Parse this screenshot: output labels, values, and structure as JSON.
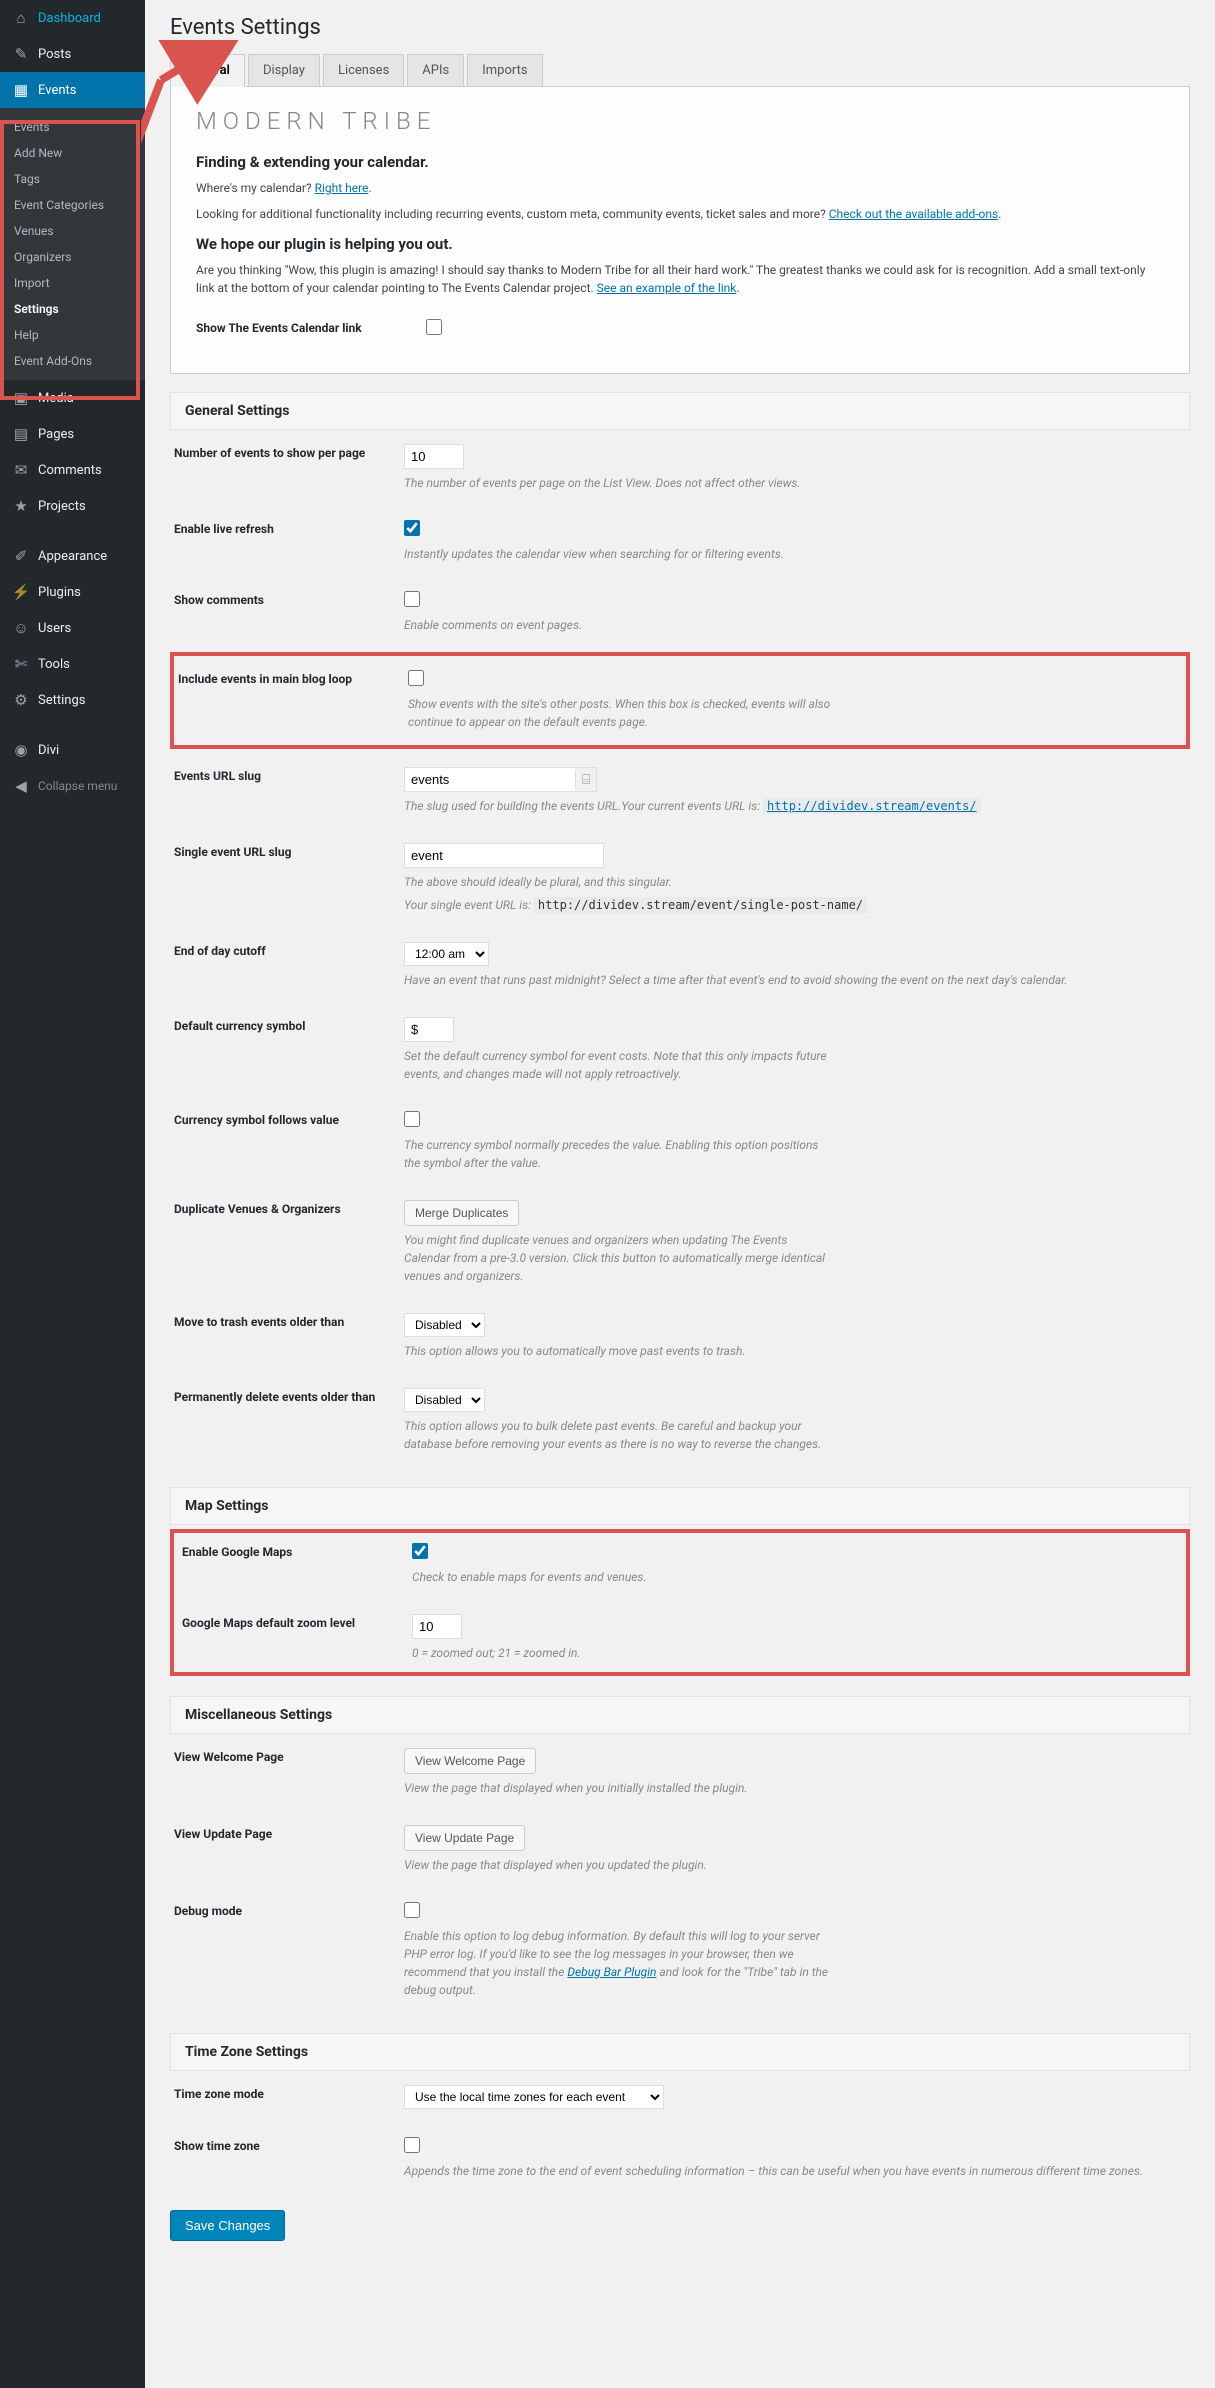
{
  "sidebar": {
    "dashboard": "Dashboard",
    "posts": "Posts",
    "events": "Events",
    "events_sub": [
      "Events",
      "Add New",
      "Tags",
      "Event Categories",
      "Venues",
      "Organizers",
      "Import",
      "Settings",
      "Help",
      "Event Add-Ons"
    ],
    "events_sub_selected_index": 7,
    "media": "Media",
    "pages": "Pages",
    "comments": "Comments",
    "projects": "Projects",
    "appearance": "Appearance",
    "plugins": "Plugins",
    "users": "Users",
    "tools": "Tools",
    "settings": "Settings",
    "divi": "Divi",
    "collapse": "Collapse menu"
  },
  "page_title": "Events Settings",
  "tabs": [
    "General",
    "Display",
    "Licenses",
    "APIs",
    "Imports"
  ],
  "intro": {
    "brand": "MODERN TRIBE",
    "h1": "Finding & extending your calendar.",
    "where_q": "Where's my calendar? ",
    "where_a": "Right here",
    "looking": "Looking for additional functionality including recurring events, custom meta, community events, ticket sales and more? ",
    "looking_link": "Check out the available add-ons",
    "h2": "We hope our plugin is helping you out.",
    "thanks": "Are you thinking \"Wow, this plugin is amazing! I should say thanks to Modern Tribe for all their hard work.\" The greatest thanks we could ask for is recognition. Add a small text-only link at the bottom of your calendar pointing to The Events Calendar project. ",
    "thanks_link": "See an example of the link",
    "show_link_label": "Show The Events Calendar link"
  },
  "sections": {
    "general": "General Settings",
    "map": "Map Settings",
    "misc": "Miscellaneous Settings",
    "tz": "Time Zone Settings"
  },
  "fields": {
    "num_events": {
      "label": "Number of events to show per page",
      "value": "10",
      "desc": "The number of events per page on the List View. Does not affect other views."
    },
    "live_refresh": {
      "label": "Enable live refresh",
      "desc": "Instantly updates the calendar view when searching for or filtering events."
    },
    "show_comments": {
      "label": "Show comments",
      "desc": "Enable comments on event pages."
    },
    "include_loop": {
      "label": "Include events in main blog loop",
      "desc": "Show events with the site's other posts. When this box is checked, events will also continue to appear on the default events page."
    },
    "url_slug": {
      "label": "Events URL slug",
      "value": "events",
      "desc_pre": "The slug used for building the events URL.Your current events URL is: ",
      "desc_link": "http://dividev.stream/events/"
    },
    "single_slug": {
      "label": "Single event URL slug",
      "value": "event",
      "desc1": "The above should ideally be plural, and this singular.",
      "desc2_pre": "Your single event URL is: ",
      "desc2_code": "http://dividev.stream/event/single-post-name/"
    },
    "cutoff": {
      "label": "End of day cutoff",
      "value": "12:00 am",
      "desc": "Have an event that runs past midnight? Select a time after that event's end to avoid showing the event on the next day's calendar."
    },
    "currency": {
      "label": "Default currency symbol",
      "value": "$",
      "desc": "Set the default currency symbol for event costs. Note that this only impacts future events, and changes made will not apply retroactively."
    },
    "currency_follow": {
      "label": "Currency symbol follows value",
      "desc": "The currency symbol normally precedes the value. Enabling this option positions the symbol after the value."
    },
    "duplicates": {
      "label": "Duplicate Venues & Organizers",
      "btn": "Merge Duplicates",
      "desc": "You might find duplicate venues and organizers when updating The Events Calendar from a pre-3.0 version. Click this button to automatically merge identical venues and organizers."
    },
    "trash": {
      "label": "Move to trash events older than",
      "value": "Disabled",
      "desc": "This option allows you to automatically move past events to trash."
    },
    "perm_delete": {
      "label": "Permanently delete events older than",
      "value": "Disabled",
      "desc": "This option allows you to bulk delete past events. Be careful and backup your database before removing your events as there is no way to reverse the changes."
    },
    "gmaps": {
      "label": "Enable Google Maps",
      "desc": "Check to enable maps for events and venues."
    },
    "gmaps_zoom": {
      "label": "Google Maps default zoom level",
      "value": "10",
      "desc": "0 = zoomed out; 21 = zoomed in."
    },
    "welcome": {
      "label": "View Welcome Page",
      "btn": "View Welcome Page",
      "desc": "View the page that displayed when you initially installed the plugin."
    },
    "update": {
      "label": "View Update Page",
      "btn": "View Update Page",
      "desc": "View the page that displayed when you updated the plugin."
    },
    "debug": {
      "label": "Debug mode",
      "desc_pre": "Enable this option to log debug information. By default this will log to your server PHP error log. If you'd like to see the log messages in your browser, then we recommend that you install the ",
      "desc_link": "Debug Bar Plugin",
      "desc_post": " and look for the \"Tribe\" tab in the debug output."
    },
    "tz_mode": {
      "label": "Time zone mode",
      "value": "Use the local time zones for each event"
    },
    "show_tz": {
      "label": "Show time zone",
      "desc": "Appends the time zone to the end of event scheduling information – this can be useful when you have events in numerous different time zones."
    }
  },
  "save_btn": "Save Changes",
  "period": "."
}
